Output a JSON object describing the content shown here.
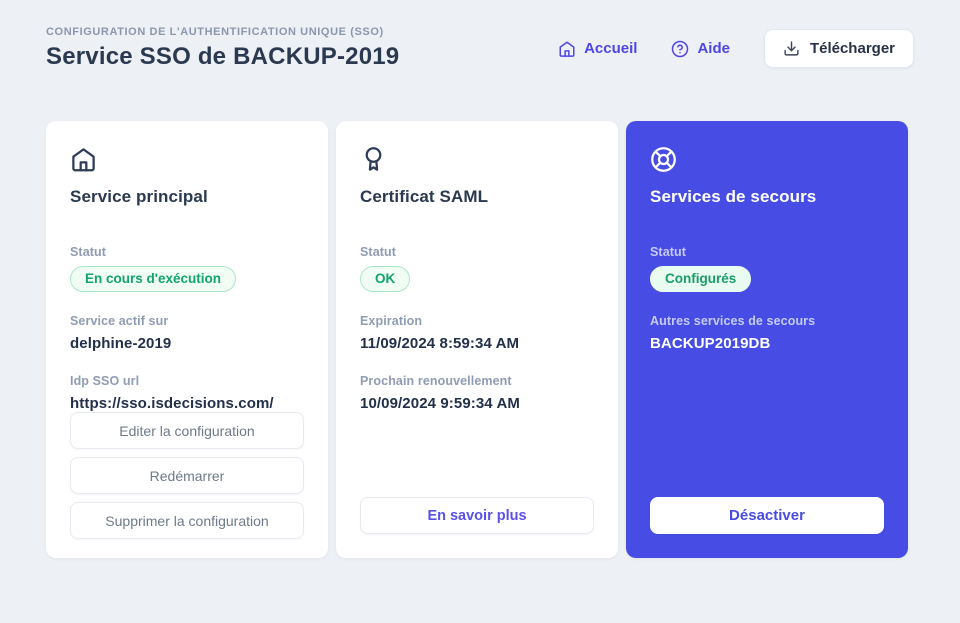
{
  "page": {
    "eyebrow": "CONFIGURATION DE L'AUTHENTIFICATION UNIQUE (SSO)",
    "title": "Service SSO de BACKUP-2019"
  },
  "header": {
    "home_link": "Accueil",
    "help_link": "Aide",
    "download_button": "Télécharger"
  },
  "icons": {
    "header_home": "home-icon",
    "header_help": "help-circle-icon",
    "header_download": "download-icon",
    "card_main_service": "home-icon",
    "card_certificate": "award-icon",
    "card_backup": "life-buoy-icon"
  },
  "colors": {
    "page_background": "#edf0f5",
    "accent_indigo": "#4f46e5",
    "blue_card_background": "#474de4",
    "status_green_text": "#12a56d",
    "status_badge_background": "#f1fcf5",
    "status_badge_border": "#a9e7c6",
    "dark_text": "#2b3950",
    "muted_label": "#8f9cb3"
  },
  "cards": [
    {
      "title": "Service principal",
      "status_label": "Statut",
      "status_badge": "En cours d'exécution",
      "fields": [
        {
          "label": "Service actif sur",
          "value": "delphine-2019"
        },
        {
          "label": "Idp SSO url",
          "value": "https://sso.isdecisions.com/"
        }
      ],
      "buttons": [
        "Editer la configuration",
        "Redémarrer",
        "Supprimer la configuration"
      ]
    },
    {
      "title": "Certificat SAML",
      "status_label": "Statut",
      "status_badge": "OK",
      "fields": [
        {
          "label": "Expiration",
          "value": "11/09/2024 8:59:34 AM"
        },
        {
          "label": "Prochain renouvellement",
          "value": "10/09/2024 9:59:34 AM"
        }
      ],
      "buttons": [
        "En savoir plus"
      ]
    },
    {
      "title": "Services de secours",
      "status_label": "Statut",
      "status_badge": "Configurés",
      "fields": [
        {
          "label": "Autres services de secours",
          "value": "BACKUP2019DB"
        }
      ],
      "buttons": [
        "Désactiver"
      ]
    }
  ]
}
